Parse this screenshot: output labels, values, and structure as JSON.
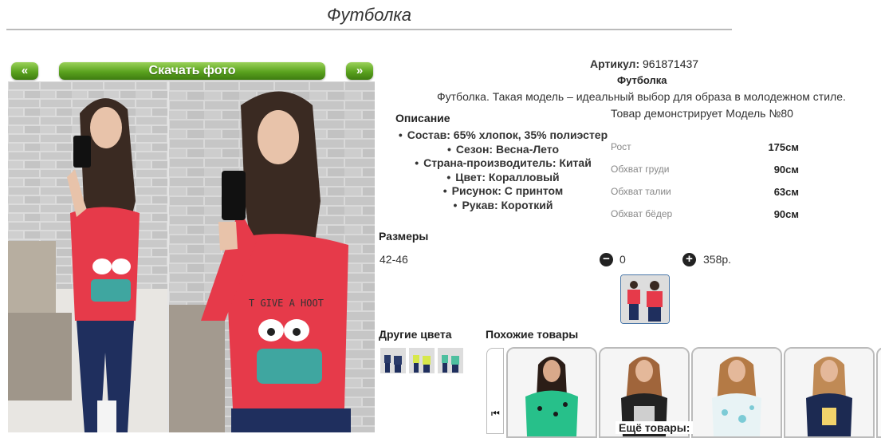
{
  "page": {
    "title": "Футболка"
  },
  "gallery": {
    "prev_label": "«",
    "next_label": "»",
    "download_label": "Скачать фото"
  },
  "product": {
    "article_label": "Артикул:",
    "article_value": "961871437",
    "name": "Футболка",
    "description": "Футболка. Такая модель – идеальный выбор для образа в молодежном стиле.",
    "model_note": "Товар демонстрирует Модель №80"
  },
  "specs": {
    "heading": "Описание",
    "items": [
      "Состав: 65% хлопок, 35% полиэстер",
      "Сезон: Весна-Лето",
      "Страна-производитель: Китай",
      "Цвет: Коралловый",
      "Рисунок: С принтом",
      "Рукав: Короткий"
    ]
  },
  "measurements": [
    {
      "label": "Рост",
      "value": "175см"
    },
    {
      "label": "Обхват груди",
      "value": "90см"
    },
    {
      "label": "Обхват талии",
      "value": "63см"
    },
    {
      "label": "Обхват бёдер",
      "value": "90см"
    }
  ],
  "sizes": {
    "heading": "Размеры",
    "rows": [
      {
        "size": "42-46",
        "minus": "−",
        "qty": "0",
        "plus": "+",
        "price": "358р."
      }
    ]
  },
  "other_colors": {
    "heading": "Другие цвета"
  },
  "similar": {
    "heading": "Похожие товары",
    "nav_icon": "⏮",
    "more_label": "Ещё товары:"
  },
  "colors": {
    "tshirt": "#e63a4a",
    "jeans": "#1f2f5e",
    "accent_green": "#5aa21e"
  }
}
